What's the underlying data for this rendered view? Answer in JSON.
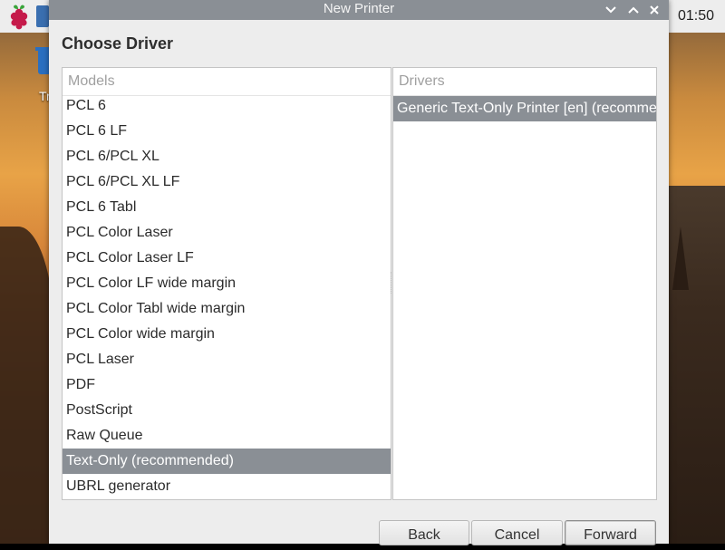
{
  "panel": {
    "clock": "01:50"
  },
  "desktop": {
    "trash_label": "Tr"
  },
  "dialog": {
    "title": "New Printer",
    "heading": "Choose Driver",
    "models_header": "Models",
    "drivers_header": "Drivers",
    "models": [
      "PCL 6",
      "PCL 6 LF",
      "PCL 6/PCL XL",
      "PCL 6/PCL XL LF",
      "PCL 6 Tabl",
      "PCL Color Laser",
      "PCL Color Laser LF",
      "PCL Color LF wide margin",
      "PCL Color Tabl wide margin",
      "PCL Color wide margin",
      "PCL Laser",
      "PDF",
      "PostScript",
      "Raw Queue",
      "Text-Only (recommended)",
      "UBRL generator"
    ],
    "selected_model": "Text-Only (recommended)",
    "drivers": [
      "Generic Text-Only Printer [en] (recommended)"
    ],
    "selected_driver": "Generic Text-Only Printer [en] (recommended)",
    "buttons": {
      "back": "Back",
      "cancel": "Cancel",
      "forward": "Forward"
    }
  },
  "icons": {
    "menu": "raspberry-pi-icon",
    "minimize": "chevron-down-icon",
    "maximize": "chevron-up-icon",
    "close": "close-icon",
    "trash": "trash-icon"
  },
  "colors": {
    "selection": "#8a8f95",
    "titlebar": "#8a8f95",
    "panel": "#ededed"
  }
}
